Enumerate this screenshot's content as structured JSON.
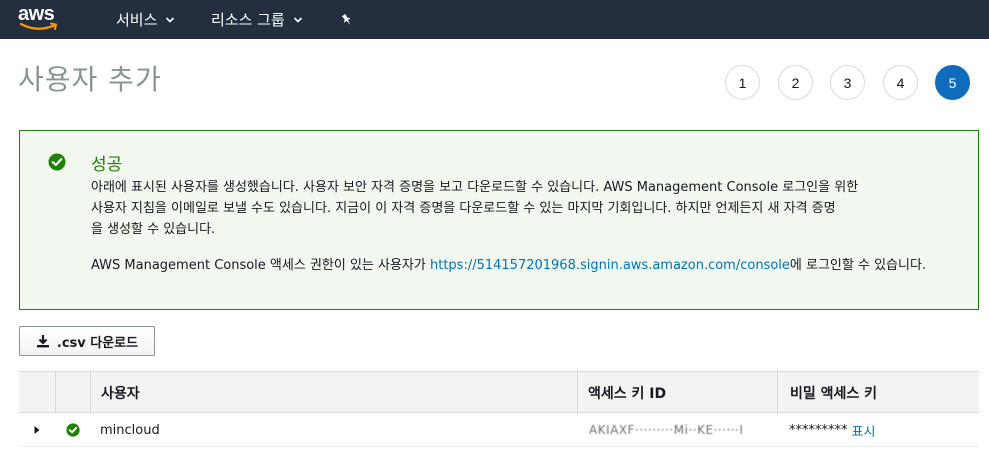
{
  "nav": {
    "logo": "aws",
    "services_label": "서비스",
    "resource_groups_label": "리소스 그룹"
  },
  "header": {
    "title": "사용자 추가",
    "steps": [
      "1",
      "2",
      "3",
      "4",
      "5"
    ],
    "active_step": "5"
  },
  "success": {
    "title": "성공",
    "line1": "아래에 표시된 사용자를 생성했습니다. 사용자 보안 자격 증명을 보고 다운로드할 수 있습니다. AWS Management Console 로그인을 위한",
    "line2": "사용자 지침을 이메일로 보낼 수도 있습니다. 지금이 이 자격 증명을 다운로드할 수 있는 마지막 기회입니다. 하지만 언제든지 새 자격 증명",
    "line3": "을 생성할 수 있습니다.",
    "console_prefix": "AWS Management Console 액세스 권한이 있는 사용자가 ",
    "console_url": "https://514157201968.signin.aws.amazon.com/console",
    "console_suffix": "에 로그인할 수 있습니다."
  },
  "download": {
    "label": ".csv 다운로드"
  },
  "table": {
    "headers": [
      "",
      "",
      "사용자",
      "액세스 키 ID",
      "비밀 액세스 키"
    ],
    "rows": [
      {
        "user": "mincloud",
        "access_key_id": "AKIAXF·········Mi··KE······I",
        "secret_masked": "*********",
        "show_label": "표시"
      }
    ]
  },
  "colors": {
    "nav_bg": "#232f3e",
    "success_green": "#1d8102",
    "success_bg": "#f2f8f0",
    "link_blue": "#0073bb",
    "active_step_blue": "#0f6cbd"
  }
}
